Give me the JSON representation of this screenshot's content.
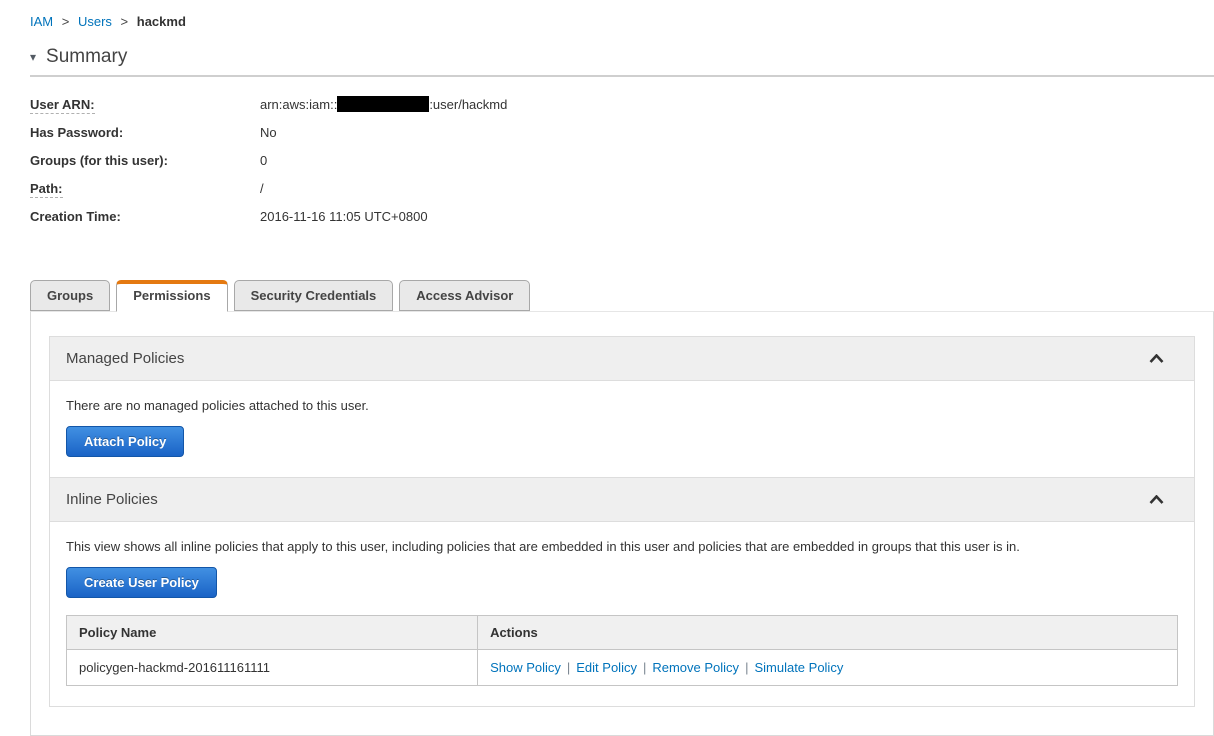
{
  "colors": {
    "link_blue": "#0073bb",
    "tab_active_orange": "#e47911",
    "primary_button_blue": "#1a63c6",
    "section_header_gray": "#efefef"
  },
  "breadcrumb": {
    "separator": ">",
    "items": [
      {
        "label": "IAM"
      },
      {
        "label": "Users"
      },
      {
        "label": "hackmd"
      }
    ]
  },
  "summary": {
    "collapse_caret": "▾",
    "title": "Summary",
    "fields": {
      "user_arn": {
        "label": "User ARN:",
        "value_prefix": "arn:aws:iam::",
        "account_id_redacted": true,
        "value_suffix": ":user/hackmd"
      },
      "has_password": {
        "label": "Has Password:",
        "value": "No"
      },
      "groups": {
        "label": "Groups (for this user):",
        "value": "0"
      },
      "path": {
        "label": "Path:",
        "value": "/"
      },
      "creation_time": {
        "label": "Creation Time:",
        "value": "2016-11-16 11:05 UTC+0800"
      }
    }
  },
  "tabs": {
    "items": [
      {
        "label": "Groups",
        "active": false
      },
      {
        "label": "Permissions",
        "active": true
      },
      {
        "label": "Security Credentials",
        "active": false
      },
      {
        "label": "Access Advisor",
        "active": false
      }
    ]
  },
  "managed_policies": {
    "title": "Managed Policies",
    "collapse_icon": "chevron-up",
    "empty_message": "There are no managed policies attached to this user.",
    "attach_button_label": "Attach Policy"
  },
  "inline_policies": {
    "title": "Inline Policies",
    "collapse_icon": "chevron-up",
    "description": "This view shows all inline policies that apply to this user, including policies that are embedded in this user and policies that are embedded in groups that this user is in.",
    "create_button_label": "Create User Policy",
    "table": {
      "headers": [
        "Policy Name",
        "Actions"
      ],
      "actions_separator": "|",
      "rows": [
        {
          "policy_name": "policygen-hackmd-201611161111",
          "actions": [
            "Show Policy",
            "Edit Policy",
            "Remove Policy",
            "Simulate Policy"
          ]
        }
      ]
    }
  }
}
